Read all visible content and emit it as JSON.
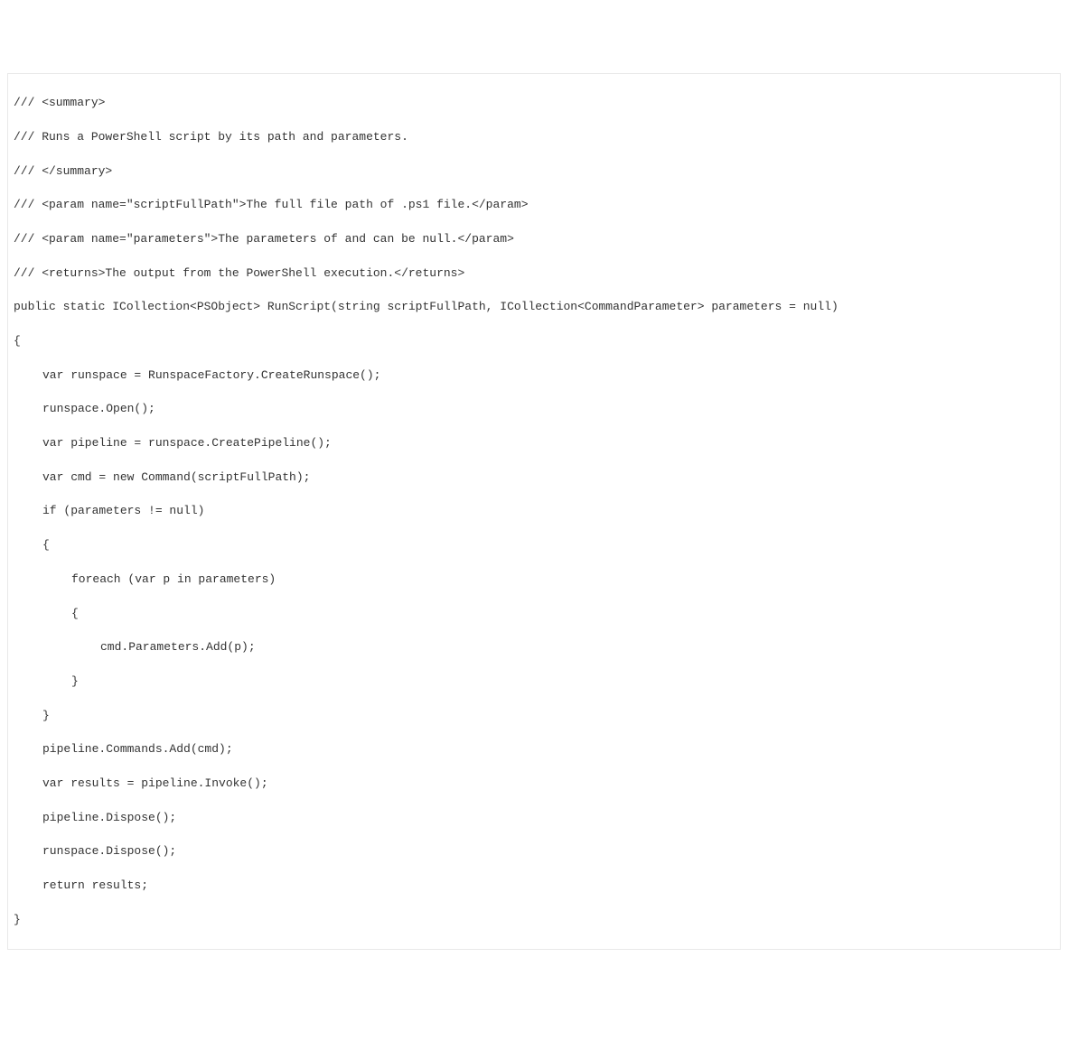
{
  "code": {
    "l1": "/// <summary>",
    "l2": "/// Runs a PowerShell script by its path and parameters.",
    "l3": "/// </summary>",
    "l4": "/// <param name=\"scriptFullPath\">The full file path of .ps1 file.</param>",
    "l5": "/// <param name=\"parameters\">The parameters of and can be null.</param>",
    "l6": "/// <returns>The output from the PowerShell execution.</returns>",
    "l7": "public static ICollection<PSObject> RunScript(string scriptFullPath, ICollection<CommandParameter> parameters = null)",
    "l8": "{",
    "l9": "var runspace = RunspaceFactory.CreateRunspace();",
    "l10": "runspace.Open();",
    "l11": "var pipeline = runspace.CreatePipeline();",
    "l12": "var cmd = new Command(scriptFullPath);",
    "l13": "if (parameters != null)",
    "l14": "{",
    "l15": "foreach (var p in parameters)",
    "l16": "{",
    "l17": "cmd.Parameters.Add(p);",
    "l18": "}",
    "l19": "}",
    "l20": "pipeline.Commands.Add(cmd);",
    "l21": "var results = pipeline.Invoke();",
    "l22": "pipeline.Dispose();",
    "l23": "runspace.Dispose();",
    "l24": "return results;",
    "l25": "}"
  }
}
